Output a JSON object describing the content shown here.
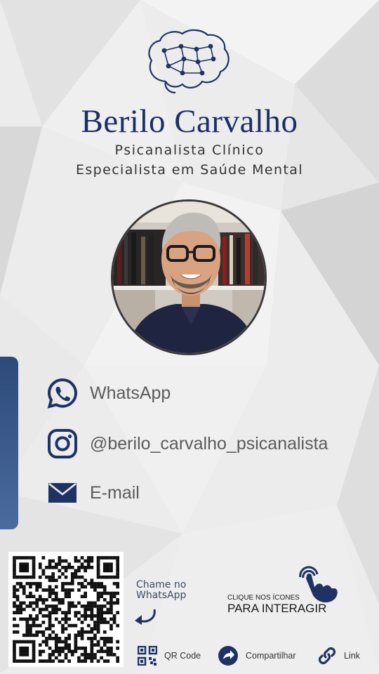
{
  "header": {
    "name": "Berilo Carvalho",
    "subtitle_1": "Psicanalista Clínico",
    "subtitle_2": "Especialista em Saúde Mental"
  },
  "contacts": [
    {
      "label": "WhatsApp",
      "icon": "whatsapp-icon"
    },
    {
      "label": "@berilo_carvalho_psicanalista",
      "icon": "instagram-icon"
    },
    {
      "label": "E-mail",
      "icon": "mail-icon"
    }
  ],
  "cta": {
    "chame_line1": "Chame no",
    "chame_line2": "WhatsApp",
    "clique_small": "CLIQUE NOS ÍCONES",
    "clique_big": "PARA INTERAGIR"
  },
  "bottom_bar": [
    {
      "label": "QR Code",
      "icon": "qr-code-icon"
    },
    {
      "label": "Compartilhar",
      "icon": "share-icon"
    },
    {
      "label": "Link",
      "icon": "link-icon"
    }
  ],
  "colors": {
    "navy": "#1b2f66",
    "icon_navy": "#1e3263",
    "text_gray": "#5b5b5b"
  }
}
